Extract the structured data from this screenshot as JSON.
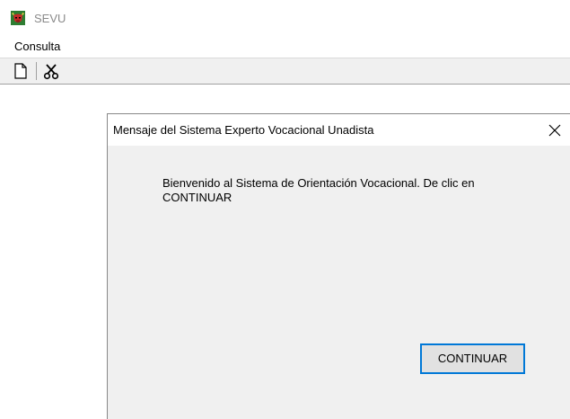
{
  "app": {
    "title": "SEVU",
    "icon": "bull-head-icon"
  },
  "menubar": {
    "items": [
      {
        "label": "Consulta"
      }
    ]
  },
  "toolbar": {
    "buttons": [
      {
        "icon": "new-document-icon"
      },
      {
        "icon": "cut-scissors-icon"
      }
    ]
  },
  "dialog": {
    "title": "Mensaje del Sistema Experto Vocacional Unadista",
    "message": "Bienvenido al Sistema de Orientación Vocacional. De clic en CONTINUAR",
    "continue_label": "CONTINUAR",
    "close_icon": "close-icon"
  },
  "colors": {
    "dialog_background": "#f0f0f0",
    "focus_border": "#0078d7",
    "app_title_text": "#8a8a8a"
  }
}
